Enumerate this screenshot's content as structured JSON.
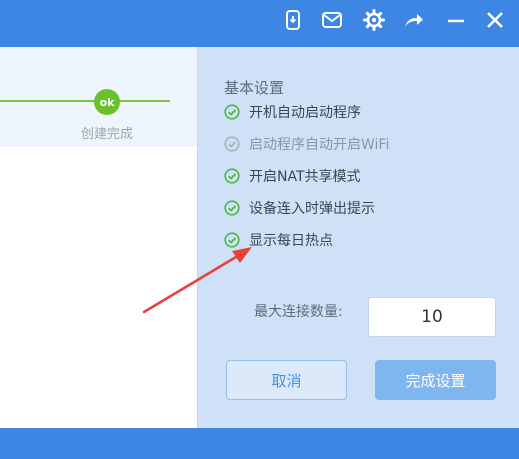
{
  "colors": {
    "accent": "#3e86e3",
    "check_green": "#4cb848",
    "check_gray": "#a9b2bb",
    "arrow_red": "#e8403a"
  },
  "titlebar": {
    "icons": [
      "phone-icon",
      "mail-icon",
      "gear-icon",
      "share-icon",
      "minimize-icon",
      "close-icon"
    ]
  },
  "progress": {
    "node_label": "ok",
    "step_label": "创建完成"
  },
  "settings": {
    "title": "基本设置",
    "options": [
      {
        "label": "开机自动启动程序",
        "checked": true
      },
      {
        "label": "启动程序自动开启WiFi",
        "checked": false
      },
      {
        "label": "开启NAT共享模式",
        "checked": true
      },
      {
        "label": "设备连入时弹出提示",
        "checked": true
      },
      {
        "label": "显示每日热点",
        "checked": true
      }
    ],
    "max_label": "最大连接数量:",
    "max_value": "10",
    "cancel_label": "取消",
    "done_label": "完成设置"
  }
}
